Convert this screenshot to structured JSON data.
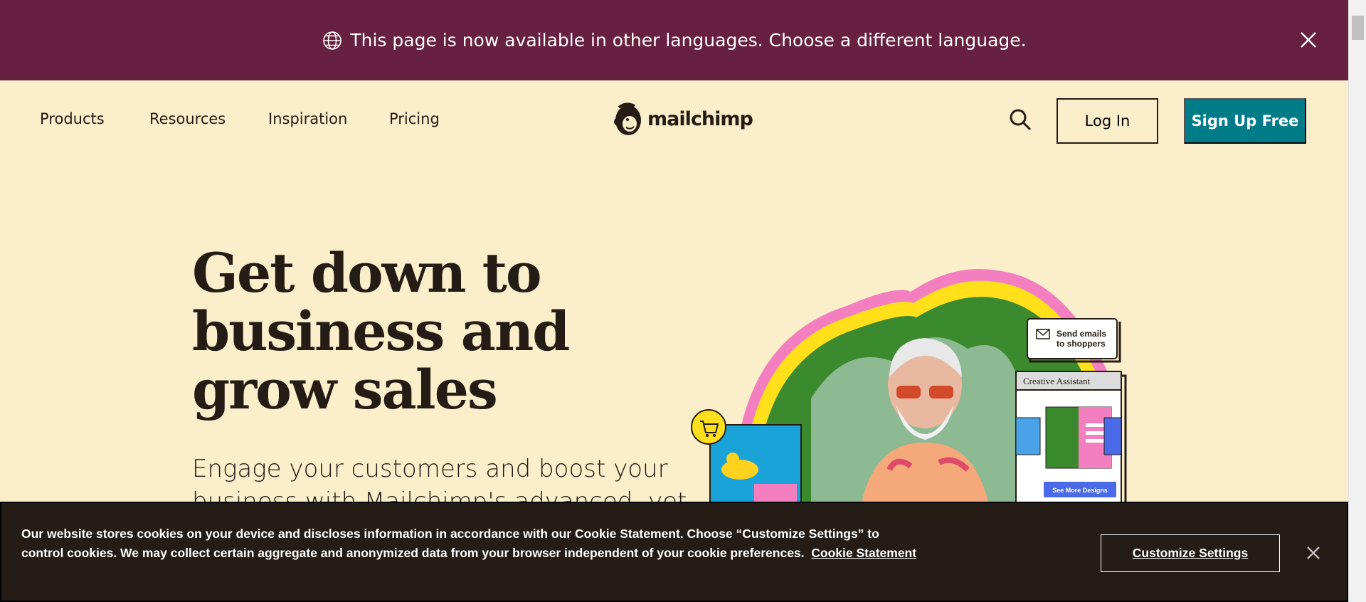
{
  "language_banner": {
    "message": "This page is now available in other languages. Choose a different language.",
    "icon": "globe-icon",
    "close_icon": "close-icon",
    "background": "#67203f"
  },
  "nav": {
    "items": [
      {
        "label": "Products"
      },
      {
        "label": "Resources"
      },
      {
        "label": "Inspiration"
      },
      {
        "label": "Pricing"
      }
    ],
    "logo_text": "mailchimp",
    "search_icon": "search-icon",
    "login_label": "Log In",
    "signup_label": "Sign Up Free",
    "accent": "#007c89"
  },
  "hero": {
    "title": "Get down to business and grow sales",
    "subtitle": "Engage your customers and boost your business with Mailchimp's advanced, yet",
    "art": {
      "bubble_label": "Send emails to shoppers",
      "panel_title": "Creative Assistant",
      "panel_button": "See More Designs",
      "cart_icon": "cart-icon",
      "mail_icon": "mail-icon"
    }
  },
  "cookie_banner": {
    "text": "Our website stores cookies on your device and discloses information in accordance with our Cookie Statement. Choose “Customize Settings” to control cookies. We may collect certain aggregate and anonymized data from your browser independent of your cookie preferences.",
    "link_label": "Cookie Statement",
    "customize_label": "Customize Settings",
    "close_icon": "close-icon"
  },
  "colors": {
    "page_background": "#fbeeca",
    "text": "#241c15",
    "cookie_background": "#241c15"
  }
}
